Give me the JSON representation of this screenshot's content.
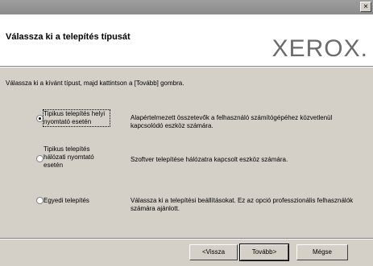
{
  "window": {
    "close_glyph": "×"
  },
  "header": {
    "title": "Válassza ki a telepítés típusát",
    "logo": "XEROX."
  },
  "instruction": "Válassza ki a kívánt típust, majd kattintson a [Tovább] gombra.",
  "options": [
    {
      "label": "Tipikus telepítés helyi nyomtató esetén",
      "description": "Alapértelmezett összetevők a felhasználó számítógépéhez közvetlenül kapcsolódó eszköz számára.",
      "selected": true
    },
    {
      "label": "Tipikus telepítés hálózati nyomtató esetén",
      "description": "Szoftver telepítése hálózatra kapcsolt eszköz számára.",
      "selected": false
    },
    {
      "label": "Egyedi telepítés",
      "description": "Válassza ki a telepítési beállításokat. Ez az opció professzionális felhasználók számára ajánlott.",
      "selected": false
    }
  ],
  "buttons": {
    "back": "<Vissza",
    "next": "Tovább>",
    "cancel": "Mégse"
  }
}
